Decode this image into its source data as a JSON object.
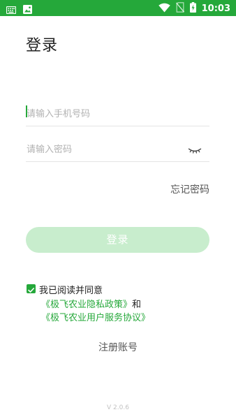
{
  "status_bar": {
    "time": "10:03",
    "icons": [
      "keyboard-icon",
      "image-icon",
      "wifi-icon",
      "no-sim-icon",
      "battery-charging-icon"
    ]
  },
  "login": {
    "title": "登录",
    "phone_placeholder": "请输入手机号码",
    "password_placeholder": "请输入密码",
    "forgot_password": "忘记密码",
    "login_button": "登录"
  },
  "agreement": {
    "checked": true,
    "text": "我已阅读并同意",
    "privacy_link": "《极飞农业隐私政策》",
    "and": "和",
    "service_link": "《极飞农业用户服务协议》"
  },
  "register": "注册账号",
  "version": "V 2.0.6",
  "colors": {
    "accent": "#25a83a",
    "button_disabled": "#c8edcd",
    "status_bar": "#25a83a"
  }
}
